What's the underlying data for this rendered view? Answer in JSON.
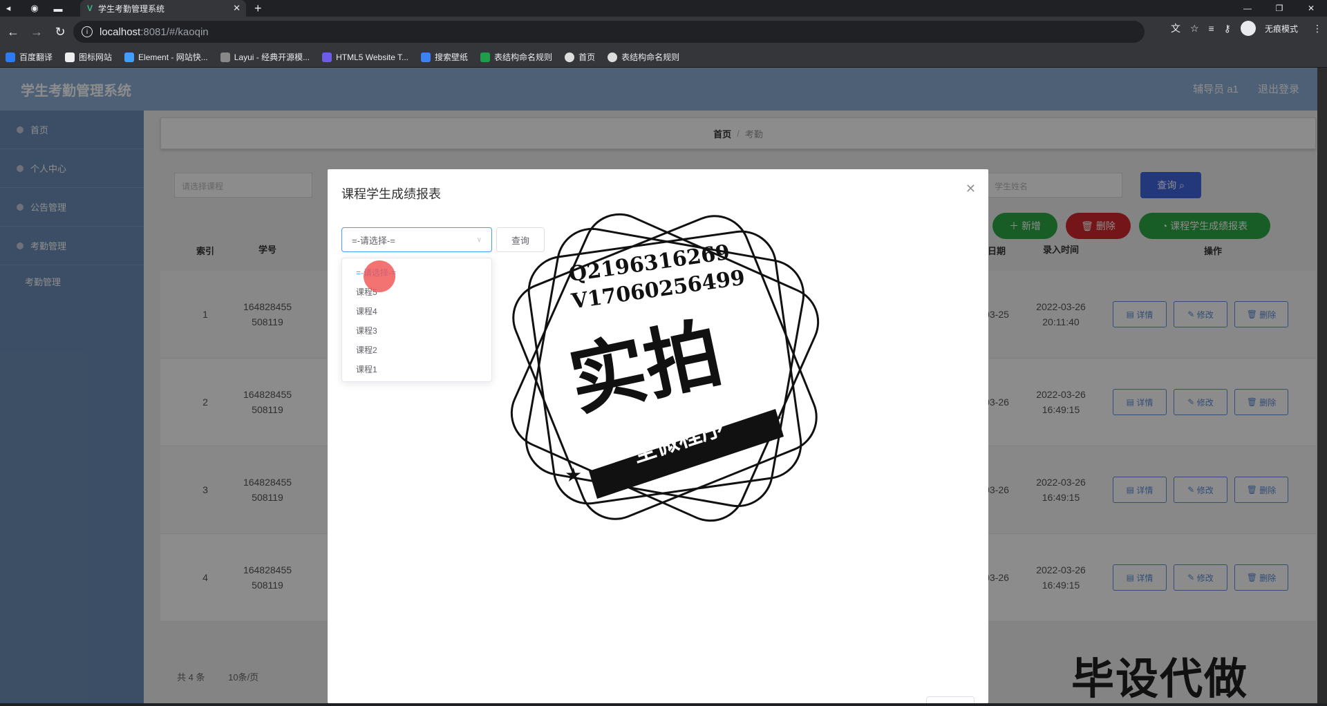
{
  "browser": {
    "tab_title": "学生考勤管理系统",
    "url_host": "localhost",
    "url_rest": ":8081/#/kaoqin",
    "incognito_label": "无痕模式",
    "bookmarks": [
      "百度翻译",
      "图标网站",
      "Element - 网站快...",
      "Layui - 经典开源模...",
      "HTML5 Website T...",
      "搜索壁纸",
      "表结构命名规则",
      "首页",
      "表结构命名规则"
    ]
  },
  "app": {
    "title": "学生考勤管理系统",
    "header_right": [
      "辅导员 a1",
      "退出登录"
    ],
    "sidebar": [
      "首页",
      "个人中心",
      "公告管理",
      "考勤管理"
    ],
    "sidebar_sub": "考勤管理",
    "breadcrumb": {
      "home": "首页",
      "sep": "/",
      "current": "考勤"
    },
    "filter_select_placeholder": "请选择课程",
    "filter_input_placeholder": "学生姓名",
    "buttons": {
      "query": "查询",
      "add": "新增",
      "delete": "删除",
      "report": "课程学生成绩报表"
    },
    "columns": [
      "索引",
      "学号",
      "日期",
      "录入时间",
      "操作"
    ],
    "rows": [
      {
        "idx": "1",
        "no1": "164828455",
        "no2": "508119",
        "date": "03-25",
        "t1": "2022-03-26",
        "t2": "20:11:40"
      },
      {
        "idx": "2",
        "no1": "164828455",
        "no2": "508119",
        "date": "03-26",
        "t1": "2022-03-26",
        "t2": "16:49:15"
      },
      {
        "idx": "3",
        "no1": "164828455",
        "no2": "508119",
        "date": "03-26",
        "t1": "2022-03-26",
        "t2": "16:49:15"
      },
      {
        "idx": "4",
        "no1": "164828455",
        "no2": "508119",
        "date": "03-26",
        "t1": "2022-03-26",
        "t2": "16:49:15"
      }
    ],
    "row_ops": [
      "详情",
      "修改",
      "删除"
    ],
    "pager": {
      "total": "共 4 条",
      "size": "10条/页"
    }
  },
  "dialog": {
    "title": "课程学生成绩报表",
    "select_value": "=-请选择-=",
    "query": "查询",
    "options": [
      "=-请选择-=",
      "课程5",
      "课程4",
      "课程3",
      "课程2",
      "课程1"
    ]
  },
  "stamp": {
    "line1": "Q2196316269",
    "line2": "V17060256499",
    "big": "实拍",
    "banner": "全微程序"
  },
  "watermark": "毕设代做"
}
